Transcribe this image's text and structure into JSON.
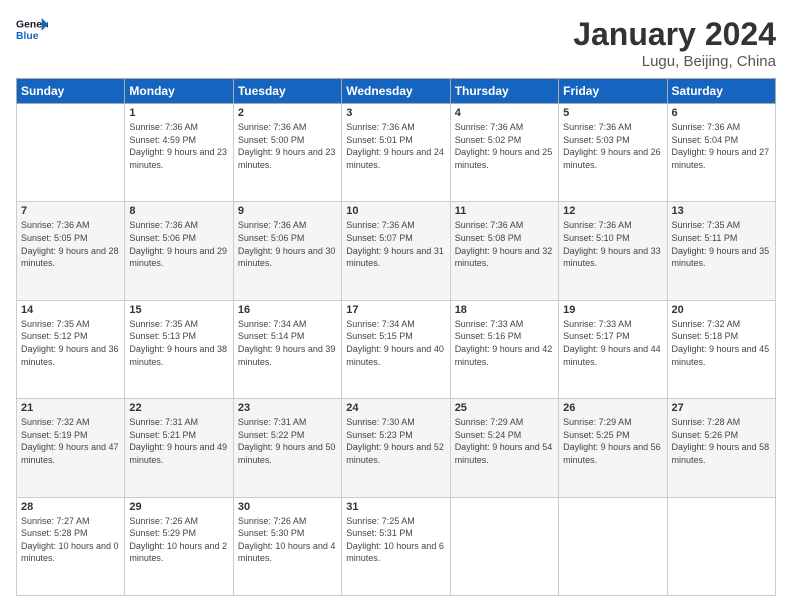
{
  "logo": {
    "line1": "General",
    "line2": "Blue"
  },
  "header": {
    "month": "January 2024",
    "location": "Lugu, Beijing, China"
  },
  "days_header": [
    "Sunday",
    "Monday",
    "Tuesday",
    "Wednesday",
    "Thursday",
    "Friday",
    "Saturday"
  ],
  "weeks": [
    [
      {
        "num": "",
        "sunrise": "",
        "sunset": "",
        "daylight": ""
      },
      {
        "num": "1",
        "sunrise": "Sunrise: 7:36 AM",
        "sunset": "Sunset: 4:59 PM",
        "daylight": "Daylight: 9 hours and 23 minutes."
      },
      {
        "num": "2",
        "sunrise": "Sunrise: 7:36 AM",
        "sunset": "Sunset: 5:00 PM",
        "daylight": "Daylight: 9 hours and 23 minutes."
      },
      {
        "num": "3",
        "sunrise": "Sunrise: 7:36 AM",
        "sunset": "Sunset: 5:01 PM",
        "daylight": "Daylight: 9 hours and 24 minutes."
      },
      {
        "num": "4",
        "sunrise": "Sunrise: 7:36 AM",
        "sunset": "Sunset: 5:02 PM",
        "daylight": "Daylight: 9 hours and 25 minutes."
      },
      {
        "num": "5",
        "sunrise": "Sunrise: 7:36 AM",
        "sunset": "Sunset: 5:03 PM",
        "daylight": "Daylight: 9 hours and 26 minutes."
      },
      {
        "num": "6",
        "sunrise": "Sunrise: 7:36 AM",
        "sunset": "Sunset: 5:04 PM",
        "daylight": "Daylight: 9 hours and 27 minutes."
      }
    ],
    [
      {
        "num": "7",
        "sunrise": "Sunrise: 7:36 AM",
        "sunset": "Sunset: 5:05 PM",
        "daylight": "Daylight: 9 hours and 28 minutes."
      },
      {
        "num": "8",
        "sunrise": "Sunrise: 7:36 AM",
        "sunset": "Sunset: 5:06 PM",
        "daylight": "Daylight: 9 hours and 29 minutes."
      },
      {
        "num": "9",
        "sunrise": "Sunrise: 7:36 AM",
        "sunset": "Sunset: 5:06 PM",
        "daylight": "Daylight: 9 hours and 30 minutes."
      },
      {
        "num": "10",
        "sunrise": "Sunrise: 7:36 AM",
        "sunset": "Sunset: 5:07 PM",
        "daylight": "Daylight: 9 hours and 31 minutes."
      },
      {
        "num": "11",
        "sunrise": "Sunrise: 7:36 AM",
        "sunset": "Sunset: 5:08 PM",
        "daylight": "Daylight: 9 hours and 32 minutes."
      },
      {
        "num": "12",
        "sunrise": "Sunrise: 7:36 AM",
        "sunset": "Sunset: 5:10 PM",
        "daylight": "Daylight: 9 hours and 33 minutes."
      },
      {
        "num": "13",
        "sunrise": "Sunrise: 7:35 AM",
        "sunset": "Sunset: 5:11 PM",
        "daylight": "Daylight: 9 hours and 35 minutes."
      }
    ],
    [
      {
        "num": "14",
        "sunrise": "Sunrise: 7:35 AM",
        "sunset": "Sunset: 5:12 PM",
        "daylight": "Daylight: 9 hours and 36 minutes."
      },
      {
        "num": "15",
        "sunrise": "Sunrise: 7:35 AM",
        "sunset": "Sunset: 5:13 PM",
        "daylight": "Daylight: 9 hours and 38 minutes."
      },
      {
        "num": "16",
        "sunrise": "Sunrise: 7:34 AM",
        "sunset": "Sunset: 5:14 PM",
        "daylight": "Daylight: 9 hours and 39 minutes."
      },
      {
        "num": "17",
        "sunrise": "Sunrise: 7:34 AM",
        "sunset": "Sunset: 5:15 PM",
        "daylight": "Daylight: 9 hours and 40 minutes."
      },
      {
        "num": "18",
        "sunrise": "Sunrise: 7:33 AM",
        "sunset": "Sunset: 5:16 PM",
        "daylight": "Daylight: 9 hours and 42 minutes."
      },
      {
        "num": "19",
        "sunrise": "Sunrise: 7:33 AM",
        "sunset": "Sunset: 5:17 PM",
        "daylight": "Daylight: 9 hours and 44 minutes."
      },
      {
        "num": "20",
        "sunrise": "Sunrise: 7:32 AM",
        "sunset": "Sunset: 5:18 PM",
        "daylight": "Daylight: 9 hours and 45 minutes."
      }
    ],
    [
      {
        "num": "21",
        "sunrise": "Sunrise: 7:32 AM",
        "sunset": "Sunset: 5:19 PM",
        "daylight": "Daylight: 9 hours and 47 minutes."
      },
      {
        "num": "22",
        "sunrise": "Sunrise: 7:31 AM",
        "sunset": "Sunset: 5:21 PM",
        "daylight": "Daylight: 9 hours and 49 minutes."
      },
      {
        "num": "23",
        "sunrise": "Sunrise: 7:31 AM",
        "sunset": "Sunset: 5:22 PM",
        "daylight": "Daylight: 9 hours and 50 minutes."
      },
      {
        "num": "24",
        "sunrise": "Sunrise: 7:30 AM",
        "sunset": "Sunset: 5:23 PM",
        "daylight": "Daylight: 9 hours and 52 minutes."
      },
      {
        "num": "25",
        "sunrise": "Sunrise: 7:29 AM",
        "sunset": "Sunset: 5:24 PM",
        "daylight": "Daylight: 9 hours and 54 minutes."
      },
      {
        "num": "26",
        "sunrise": "Sunrise: 7:29 AM",
        "sunset": "Sunset: 5:25 PM",
        "daylight": "Daylight: 9 hours and 56 minutes."
      },
      {
        "num": "27",
        "sunrise": "Sunrise: 7:28 AM",
        "sunset": "Sunset: 5:26 PM",
        "daylight": "Daylight: 9 hours and 58 minutes."
      }
    ],
    [
      {
        "num": "28",
        "sunrise": "Sunrise: 7:27 AM",
        "sunset": "Sunset: 5:28 PM",
        "daylight": "Daylight: 10 hours and 0 minutes."
      },
      {
        "num": "29",
        "sunrise": "Sunrise: 7:26 AM",
        "sunset": "Sunset: 5:29 PM",
        "daylight": "Daylight: 10 hours and 2 minutes."
      },
      {
        "num": "30",
        "sunrise": "Sunrise: 7:26 AM",
        "sunset": "Sunset: 5:30 PM",
        "daylight": "Daylight: 10 hours and 4 minutes."
      },
      {
        "num": "31",
        "sunrise": "Sunrise: 7:25 AM",
        "sunset": "Sunset: 5:31 PM",
        "daylight": "Daylight: 10 hours and 6 minutes."
      },
      {
        "num": "",
        "sunrise": "",
        "sunset": "",
        "daylight": ""
      },
      {
        "num": "",
        "sunrise": "",
        "sunset": "",
        "daylight": ""
      },
      {
        "num": "",
        "sunrise": "",
        "sunset": "",
        "daylight": ""
      }
    ]
  ]
}
